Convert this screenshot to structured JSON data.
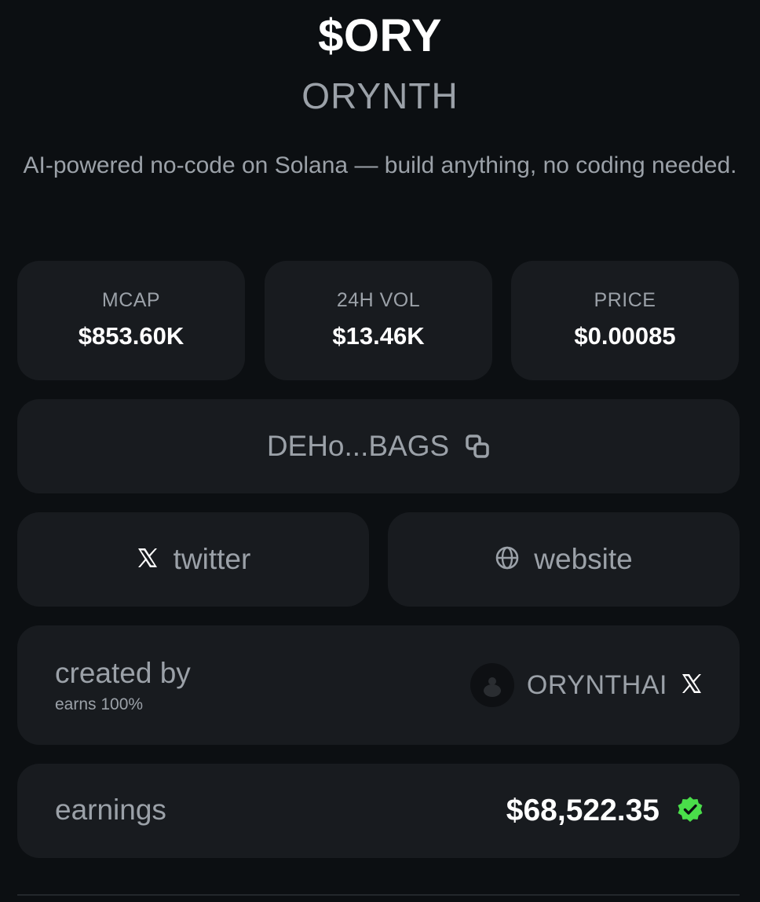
{
  "header": {
    "ticker": "$ORY",
    "name": "ORYNTH",
    "description": "AI-powered no-code on Solana — build anything, no coding needed."
  },
  "stats": {
    "mcap": {
      "label": "MCAP",
      "value": "$853.60K"
    },
    "volume": {
      "label": "24H VOL",
      "value": "$13.46K"
    },
    "price": {
      "label": "PRICE",
      "value": "$0.00085"
    }
  },
  "address": {
    "text": "DEHo...BAGS",
    "icon": "copy-icon"
  },
  "links": {
    "twitter": {
      "label": "twitter",
      "icon": "x-logo-icon"
    },
    "website": {
      "label": "website",
      "icon": "globe-icon"
    }
  },
  "creator": {
    "title": "created by",
    "subtitle": "earns 100%",
    "name": "ORYNTHAI",
    "avatar_icon": "avatar",
    "social_icon": "x-logo-icon"
  },
  "earnings": {
    "label": "earnings",
    "value": "$68,522.35",
    "badge_icon": "verified-badge-icon",
    "badge_color": "#4ade4a"
  },
  "colors": {
    "background": "#0c0f12",
    "card": "#181b1f",
    "muted_text": "#9ba1a8",
    "primary_text": "#ffffff"
  }
}
